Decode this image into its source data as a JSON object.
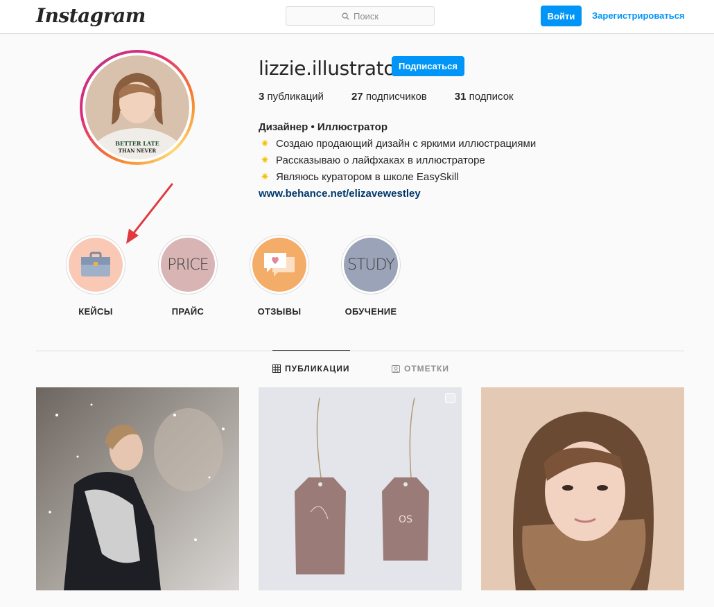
{
  "header": {
    "logo": "Instagram",
    "search_placeholder": "Поиск",
    "login_label": "Войти",
    "register_label": "Зарегистрироваться"
  },
  "profile": {
    "username": "lizzie.illustrator",
    "follow_label": "Подписаться",
    "stats": [
      {
        "count": "3",
        "label": "публикаций"
      },
      {
        "count": "27",
        "label": "подписчиков"
      },
      {
        "count": "31",
        "label": "подписок"
      }
    ],
    "bio": {
      "name": "Дизайнер • Иллюстратор",
      "lines": [
        "Создаю продающий дизайн с яркими иллюстрациями",
        "Рассказываю о лайфхаках в иллюстраторе",
        "Являюсь куратором в школе EasySkill"
      ],
      "website": "www.behance.net/elizavewestley"
    }
  },
  "highlights": [
    {
      "label": "КЕЙСЫ",
      "cover_text": "",
      "color": "#f9c9b6"
    },
    {
      "label": "ПРАЙС",
      "cover_text": "PRICE",
      "color": "#d8b4b4"
    },
    {
      "label": "ОТЗЫВЫ",
      "cover_text": "",
      "color": "#f4ad68"
    },
    {
      "label": "ОБУЧЕНИЕ",
      "cover_text": "STUDY",
      "color": "#9ba3b8"
    }
  ],
  "tabs": [
    {
      "label": "ПУБЛИКАЦИИ",
      "icon": "grid-icon",
      "active": true
    },
    {
      "label": "ОТМЕТКИ",
      "icon": "tagged-icon",
      "active": false
    }
  ],
  "colors": {
    "accent": "#0095f6",
    "link": "#00376b",
    "arrow": "#e0393e"
  }
}
